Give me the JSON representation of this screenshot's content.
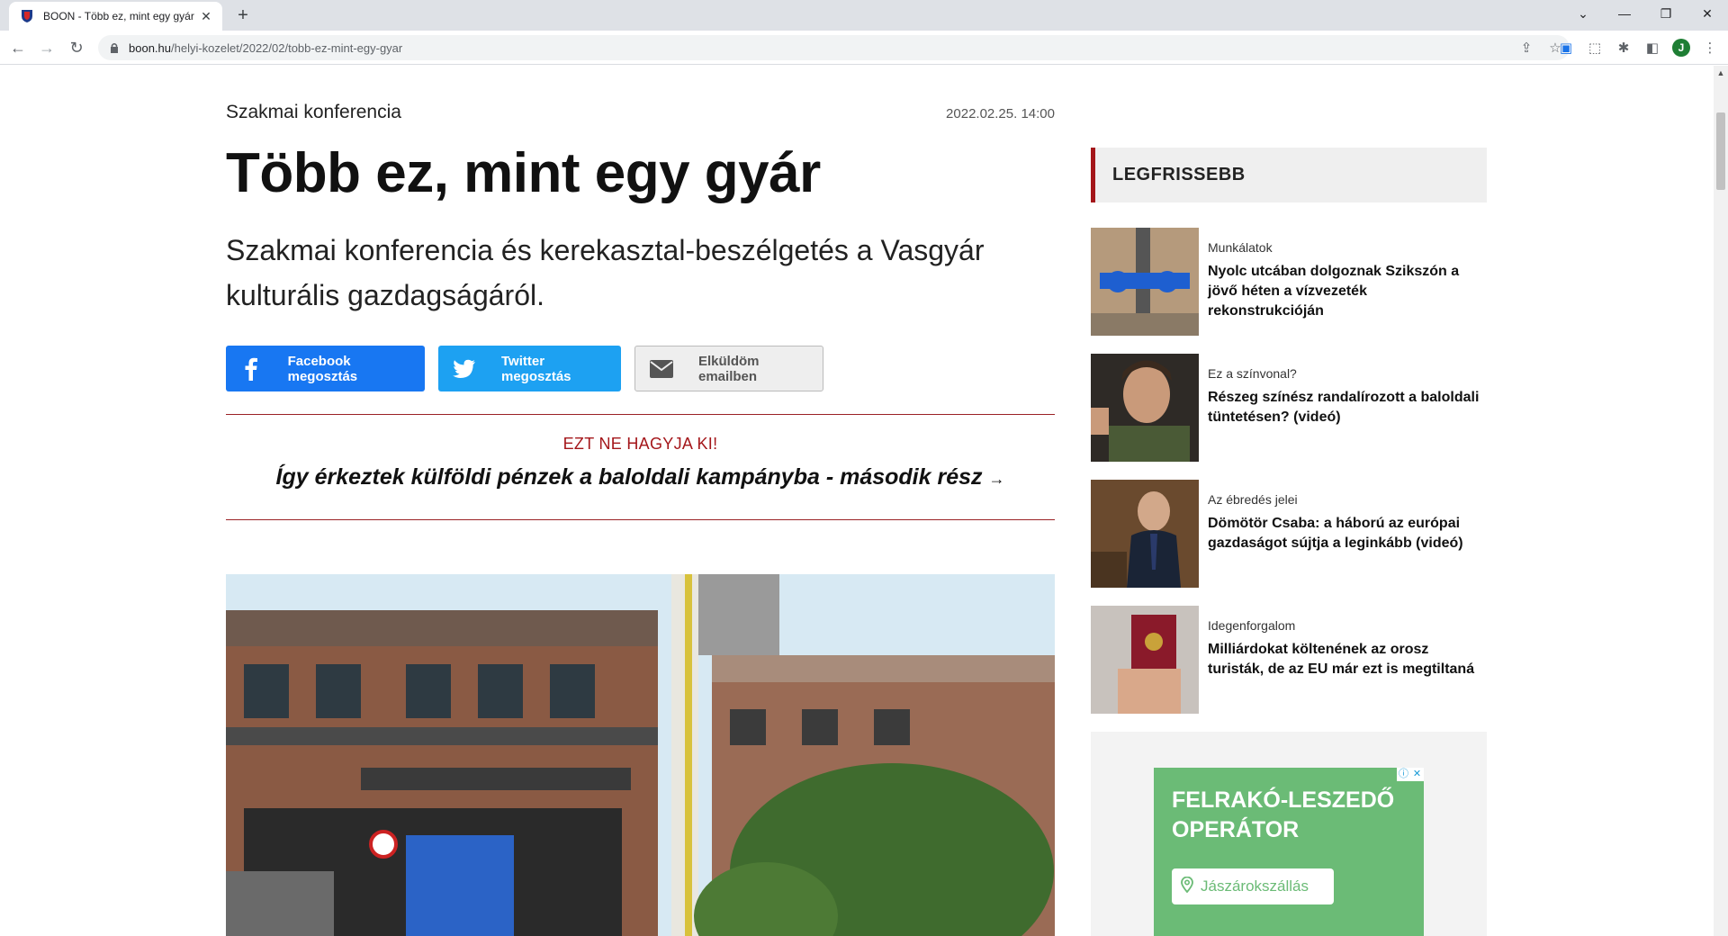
{
  "browser": {
    "tab_title": "BOON - Több ez, mint egy gyár",
    "url_host": "boon.hu",
    "url_path": "/helyi-kozelet/2022/02/tobb-ez-mint-egy-gyar",
    "profile_initial": "J"
  },
  "article": {
    "kicker": "Szakmai konferencia",
    "date": "2022.02.25. 14:00",
    "headline": "Több ez, mint egy gyár",
    "lead": "Szakmai konferencia és kerekasztal-beszélgetés a Vasgyár kulturális gazdagságáról.",
    "share": {
      "facebook": "Facebook megosztás",
      "twitter": "Twitter megosztás",
      "email": "Elküldöm emailben"
    },
    "promo": {
      "label": "EZT NE HAGYJA KI!",
      "link": "Így érkeztek külföldi pénzek a baloldali kampányba - második rész",
      "arrow": "→"
    }
  },
  "sidebar": {
    "heading": "LEGFRISSEBB",
    "items": [
      {
        "category": "Munkálatok",
        "title": "Nyolc utcában dolgoznak Szikszón a jövő héten a vízvezeték rekonstrukcióján"
      },
      {
        "category": "Ez a színvonal?",
        "title": "Részeg színész randalírozott a baloldali tüntetésen? (videó)"
      },
      {
        "category": "Az ébredés jelei",
        "title": "Dömötör Csaba: a háború az európai gazdaságot sújtja a leginkább (videó)"
      },
      {
        "category": "Idegenforgalom",
        "title": "Milliárdokat költenének az orosz turisták, de az EU már ezt is megtiltaná"
      }
    ]
  },
  "ad": {
    "title_line1": "FELRAKÓ-LESZEDŐ",
    "title_line2": "OPERÁTOR",
    "location": "Jászárokszállás"
  },
  "colors": {
    "accent_red": "#a4161a",
    "facebook": "#1877f2",
    "twitter": "#1da1f2",
    "ad_green": "#6bbb76"
  }
}
